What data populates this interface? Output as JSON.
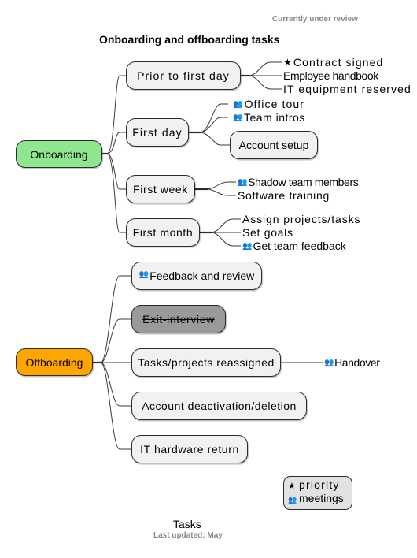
{
  "header": {
    "text": "Currently under review"
  },
  "title": {
    "text": "Onboarding and offboarding tasks"
  },
  "colors": {
    "onboarding": "#8ee68e",
    "offboarding": "#ffa500",
    "node_fill": "#f1f1f1",
    "disabled_fill": "#9a9a9a",
    "legend_fill": "#e2e2e2",
    "header_text": "#888888"
  },
  "icons": {
    "priority": "★",
    "meetings": "👥"
  },
  "onboarding": {
    "label": "Onboarding",
    "branches": [
      {
        "label": "Prior to first day",
        "children": [
          {
            "label": "Contract signed",
            "icon": "priority"
          },
          {
            "label": "Employee handbook"
          },
          {
            "label": "IT equipment reserved"
          }
        ]
      },
      {
        "label": "First day",
        "children": [
          {
            "label": "Office tour",
            "icon": "meetings"
          },
          {
            "label": "Team intros",
            "icon": "meetings"
          },
          {
            "label": "Account setup",
            "boxed": true
          }
        ]
      },
      {
        "label": "First week",
        "children": [
          {
            "label": "Shadow team members",
            "icon": "meetings"
          },
          {
            "label": "Software training"
          }
        ]
      },
      {
        "label": "First month",
        "children": [
          {
            "label": "Assign projects/tasks"
          },
          {
            "label": "Set goals"
          },
          {
            "label": "Get team feedback",
            "icon": "meetings"
          }
        ]
      }
    ]
  },
  "offboarding": {
    "label": "Offboarding",
    "branches": [
      {
        "label": "Feedback and review",
        "icon": "meetings"
      },
      {
        "label": "Exit-interview",
        "status": "struck-through"
      },
      {
        "label": "Tasks/projects reassigned",
        "children": [
          {
            "label": "Handover",
            "icon": "meetings"
          }
        ]
      },
      {
        "label": "Account deactivation/deletion"
      },
      {
        "label": "IT hardware return"
      }
    ]
  },
  "legend": {
    "items": [
      {
        "icon": "★",
        "label": "priority"
      },
      {
        "icon": "👥",
        "label": "meetings"
      }
    ]
  },
  "caption": {
    "text": "Tasks"
  },
  "footer": {
    "text": "Last updated: May"
  }
}
